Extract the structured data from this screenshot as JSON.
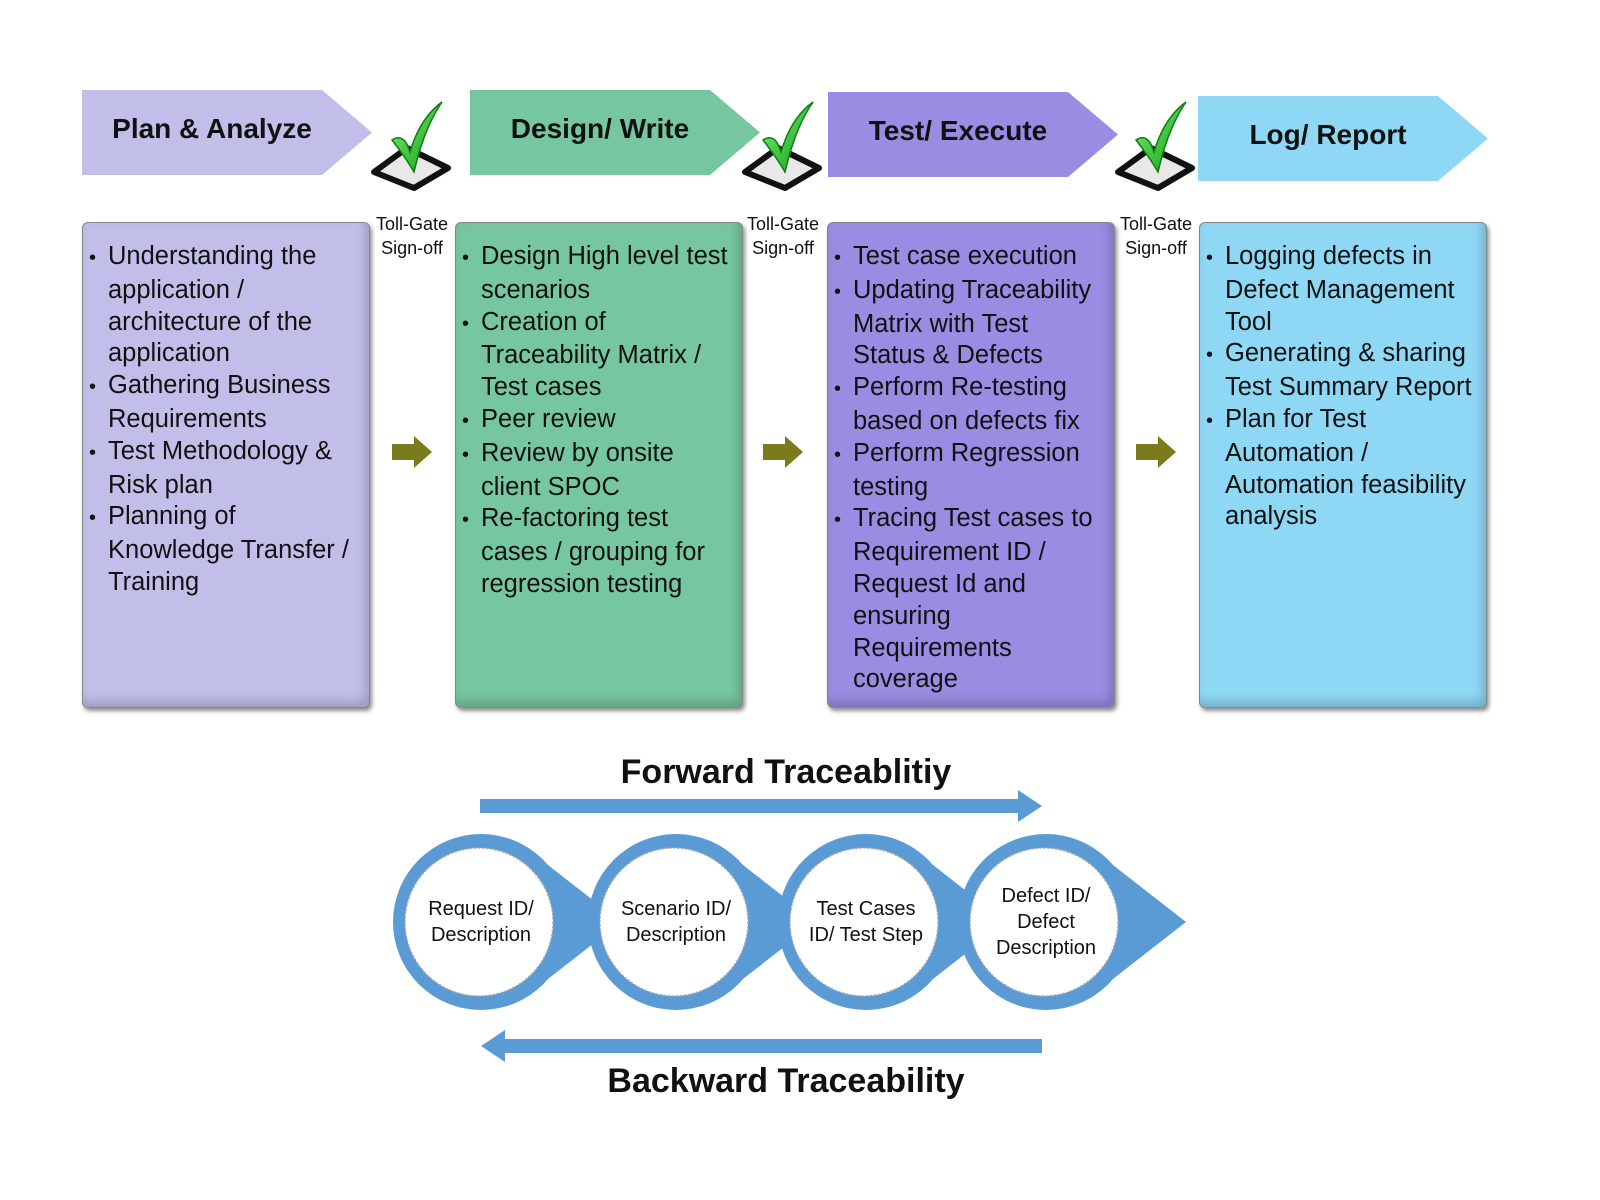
{
  "colors": {
    "plan": "#c1bfe9",
    "design": "#76c7a1",
    "test": "#9a8ce2",
    "log": "#8ed8f6",
    "gate_arrow": "#7b7a1c",
    "trace_blue": "#5b9bd5",
    "check_green": "#2fbf2f"
  },
  "phases": [
    {
      "title": "Plan & Analyze",
      "bullets": [
        "Understanding the application / architecture of the application",
        "Gathering Business Requirements",
        "Test Methodology & Risk plan",
        "Planning of Knowledge Transfer / Training"
      ]
    },
    {
      "title": "Design/ Write",
      "bullets": [
        "Design High level test scenarios",
        "Creation of Traceability Matrix / Test cases",
        "Peer review",
        "Review by onsite client SPOC",
        "Re-factoring test cases / grouping for regression testing"
      ]
    },
    {
      "title": "Test/ Execute",
      "bullets": [
        "Test case execution",
        "Updating Traceability Matrix with Test Status & Defects",
        "Perform Re-testing based on defects fix",
        "Perform Regression testing",
        "Tracing Test cases to Requirement ID / Request Id and ensuring Requirements coverage"
      ]
    },
    {
      "title": "Log/ Report",
      "bullets": [
        "Logging defects in Defect Management Tool",
        "Generating & sharing Test Summary Report",
        "Plan for Test Automation / Automation feasibility analysis"
      ]
    }
  ],
  "toll_gate": {
    "line1": "Toll-Gate",
    "line2": "Sign-off",
    "icon": "checkmark-checkbox-icon"
  },
  "traceability": {
    "forward_title": "Forward Traceablitiy",
    "backward_title": "Backward Traceability",
    "nodes": [
      [
        "Request ID/",
        "Description"
      ],
      [
        "Scenario ID/",
        "Description"
      ],
      [
        "Test Cases",
        "ID/ Test Step"
      ],
      [
        "Defect ID/",
        "Defect",
        "Description"
      ]
    ]
  }
}
